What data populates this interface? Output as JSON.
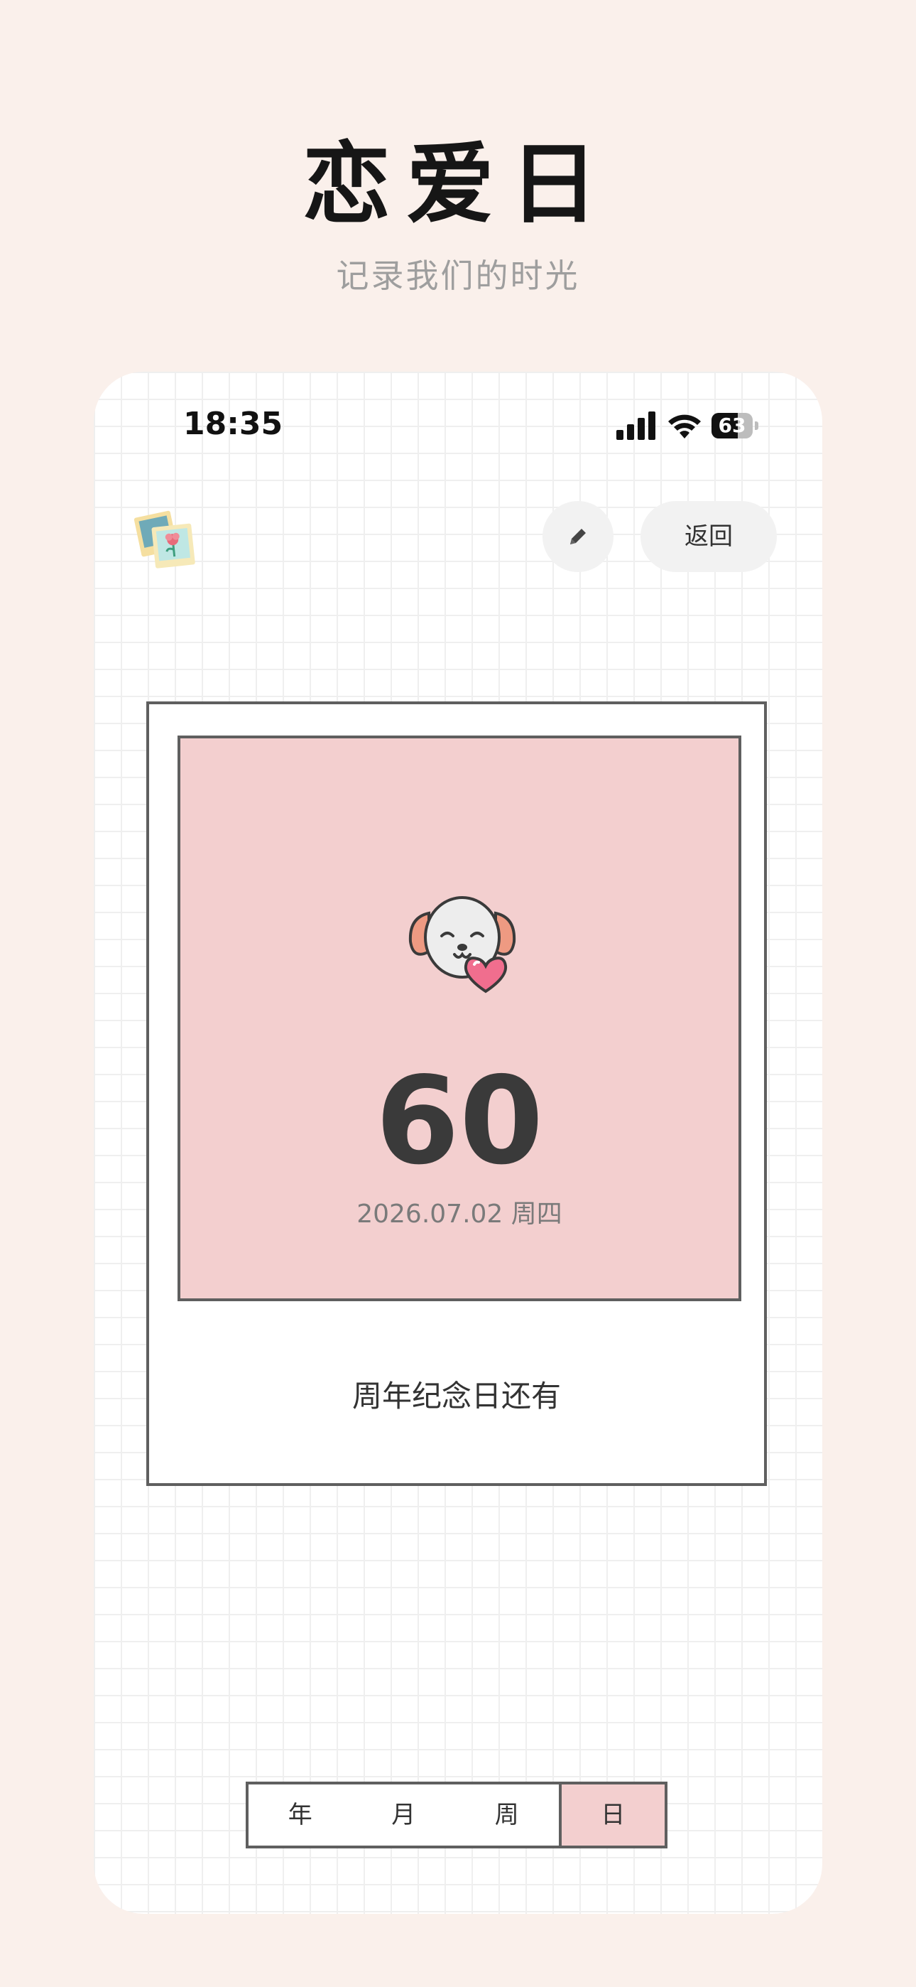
{
  "header": {
    "title": "恋爱日",
    "subtitle": "记录我们的时光"
  },
  "status_bar": {
    "time": "18:35",
    "battery": "63",
    "battery_level": 0.63,
    "icons": [
      "signal-icon",
      "wifi-icon",
      "battery-icon"
    ]
  },
  "toolbar": {
    "photo_icon": "photo-frame-icon",
    "edit_icon": "pencil-icon",
    "back_label": "返回"
  },
  "card": {
    "icon": "dog-with-heart-icon",
    "count": "60",
    "date": "2026.07.02 周四",
    "caption": "周年纪念日还有"
  },
  "segments": {
    "items": [
      "年",
      "月",
      "周",
      "日"
    ],
    "selected": "日"
  },
  "colors": {
    "page_bg": "#FAF0EB",
    "accent_pink": "#F3CFCF",
    "border": "#5F5F5F",
    "number": "#3A3A3A"
  }
}
